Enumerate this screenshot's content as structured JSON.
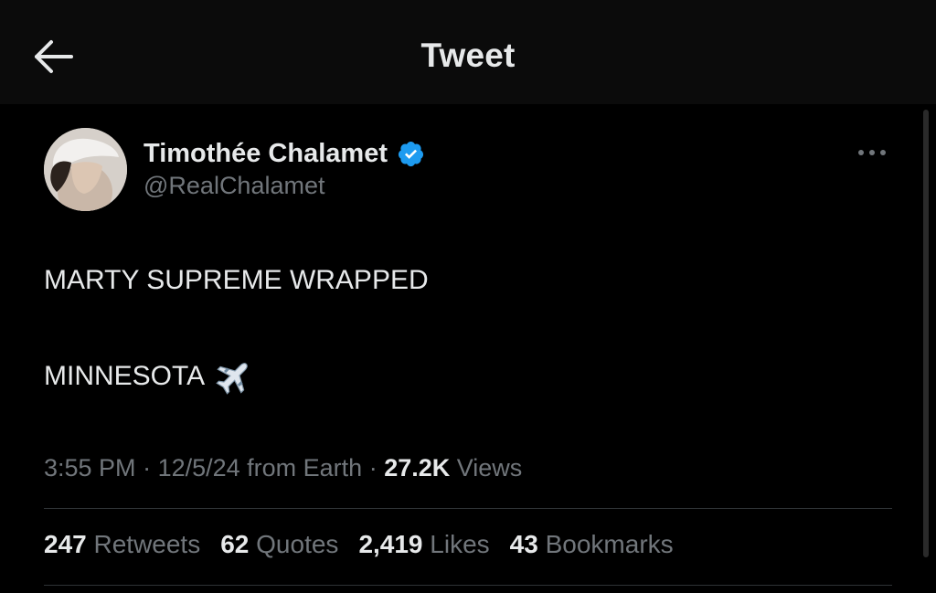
{
  "header": {
    "title": "Tweet",
    "back_icon": "arrow-left-icon"
  },
  "author": {
    "display_name": "Timothée Chalamet",
    "handle": "@RealChalamet",
    "verified": true,
    "verified_color": "#1d9bf0",
    "avatar_icon": "avatar-photo"
  },
  "more_icon": "more-horizontal-icon",
  "tweet": {
    "line1": "MARTY SUPREME WRAPPED",
    "line2": "MINNESOTA",
    "emoji_icon": "airplane-icon"
  },
  "meta": {
    "time": "3:55 PM",
    "sep1": " · ",
    "date": "12/5/24",
    "source": " from Earth",
    "sep2": " · ",
    "views_count": "27.2K",
    "views_label": " Views"
  },
  "stats": {
    "retweets_count": "247",
    "retweets_label": " Retweets",
    "quotes_count": "62",
    "quotes_label": " Quotes",
    "likes_count": "2,419",
    "likes_label": " Likes",
    "bookmarks_count": "43",
    "bookmarks_label": " Bookmarks"
  },
  "colors": {
    "background": "#000000",
    "header_bg": "#0b0b0b",
    "primary_text": "#e7e9ea",
    "secondary_text": "#71767b",
    "divider": "#2f3336"
  }
}
